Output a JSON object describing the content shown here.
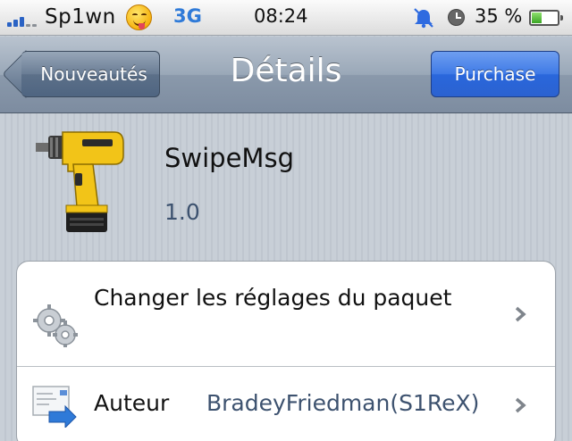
{
  "status_bar": {
    "carrier": "Sp1wn",
    "network": "3G",
    "time": "08:24",
    "battery_text": "35 %",
    "battery_level": 0.35,
    "signal_icon": "signal-bars-icon",
    "emoji_icon": "tongue-face-emoji-icon",
    "mute_icon": "notification-off-icon",
    "alarm_icon": "clock-icon"
  },
  "nav": {
    "back_label": "Nouveautés",
    "title": "Détails",
    "purchase_label": "Purchase"
  },
  "package": {
    "name": "SwipeMsg",
    "version": "1.0",
    "icon": "drill-icon"
  },
  "rows": {
    "settings_label": "Changer les réglages du paquet",
    "settings_icon": "gears-icon",
    "author_label": "Auteur",
    "author_value": "BradeyFriedman(S1ReX)",
    "author_icon": "document-arrow-icon"
  },
  "colors": {
    "accent_blue": "#2f6be0",
    "nav_gray": "#8a99ab",
    "background": "#c5ccd4"
  }
}
